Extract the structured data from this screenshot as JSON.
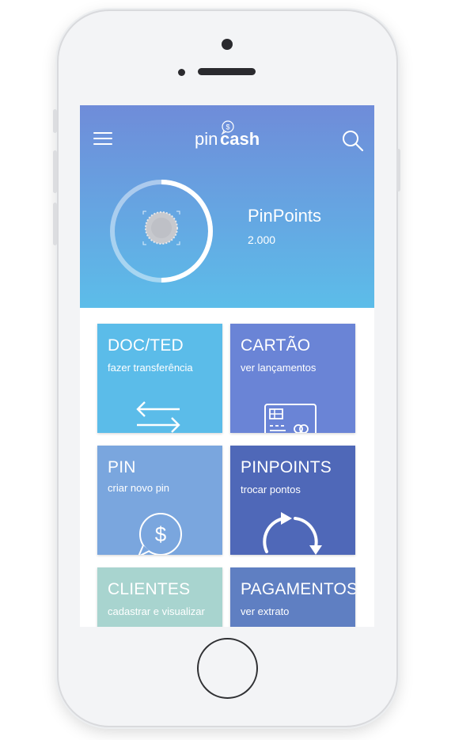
{
  "app": {
    "logo_pin": "pin",
    "logo_cash": "cash",
    "colors": {
      "header_top": "#6f8cd9",
      "header_bottom": "#5cbde9",
      "tile_doc": "#5bbce9",
      "tile_cartao": "#6a84d6",
      "tile_pin": "#7aa6de",
      "tile_pinpoints": "#4f68b8",
      "tile_clientes": "#a8d4cf",
      "tile_pagamentos": "#5f7fc2"
    }
  },
  "header": {
    "menu_icon": "hamburger-menu-icon",
    "search_icon": "search-icon"
  },
  "pinpoints": {
    "title": "PinPoints",
    "value": "2.000",
    "progress": 0.5
  },
  "tiles": [
    {
      "title": "DOC/TED",
      "subtitle": "fazer transferência",
      "icon": "transfer-arrows-icon"
    },
    {
      "title": "CARTÃO",
      "subtitle": "ver lançamentos",
      "icon": "credit-card-icon"
    },
    {
      "title": "PIN",
      "subtitle": "criar novo pin",
      "icon": "dollar-chat-icon"
    },
    {
      "title": "PINPOINTS",
      "subtitle": "trocar pontos",
      "icon": "refresh-arrows-icon"
    },
    {
      "title": "CLIENTES",
      "subtitle": "cadastrar e visualizar",
      "icon": ""
    },
    {
      "title": "PAGAMENTOS",
      "subtitle": "ver extrato",
      "icon": ""
    }
  ]
}
